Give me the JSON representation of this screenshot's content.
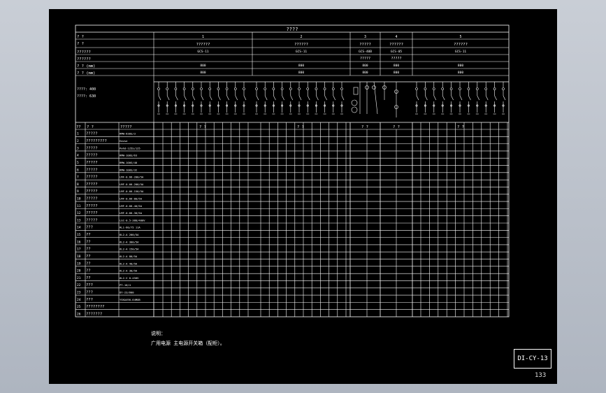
{
  "title": "????",
  "header_rows": {
    "row1_label": "? ?",
    "row2_label": "? ?",
    "row3_label": "??????",
    "row4_label": "??????",
    "row5_label": "? ? (mm)",
    "row6_label": "? ? (mm)"
  },
  "panels": [
    {
      "no": "1",
      "name": "??????",
      "model": "GCS-11",
      "w": "800",
      "d": "800",
      "extra": ""
    },
    {
      "no": "2",
      "name": "??????",
      "model": "GCS-11",
      "w": "800",
      "d": "800",
      "extra": ""
    },
    {
      "no": "3",
      "name": "?????",
      "model": "GCS-40B",
      "w": "800",
      "d": "800",
      "extra": "?????"
    },
    {
      "no": "4",
      "name": "??????",
      "model": "GCS-05",
      "w": "800",
      "d": "800",
      "extra": "?????"
    },
    {
      "no": "5",
      "name": "??????",
      "model": "GCS-11",
      "w": "800",
      "d": "800",
      "extra": ""
    }
  ],
  "scheme_notes": [
    "????: 400",
    "????: 630"
  ],
  "table_header": {
    "col1": "??",
    "col2": "?  ?",
    "col3": "?????",
    "g1": "? ?",
    "g2": "? ?",
    "g3a": "? ?",
    "g3b": "? ?",
    "g5": "? ?"
  },
  "rows": [
    {
      "no": "1",
      "name": "?????",
      "spec": "RMW-630S/3"
    },
    {
      "no": "2",
      "name": "?????????",
      "spec": "Eavse"
    },
    {
      "no": "3",
      "name": "?????",
      "spec": "Pwhd-125S/125"
    },
    {
      "no": "4",
      "name": "?????",
      "spec": "RMW-100S/63"
    },
    {
      "no": "5",
      "name": "?????",
      "spec": "RMW-100S/40"
    },
    {
      "no": "6",
      "name": "?????",
      "spec": "RMW-100S/32"
    },
    {
      "no": "7",
      "name": "?????",
      "spec": "LMF-0.66-200/5A"
    },
    {
      "no": "8",
      "name": "?????",
      "spec": "LMF-0.66-200/5A"
    },
    {
      "no": "9",
      "name": "?????",
      "spec": "LMF-0.66-150/5A"
    },
    {
      "no": "10",
      "name": "?????",
      "spec": "LMF-0.66-80/5A"
    },
    {
      "no": "11",
      "name": "?????",
      "spec": "LMF-0.66-40/5A"
    },
    {
      "no": "12",
      "name": "?????",
      "spec": "LMF-0.66-30/5A"
    },
    {
      "no": "13",
      "name": "?????",
      "spec": "LGC-0.5-380/400V"
    },
    {
      "no": "14",
      "name": "???",
      "spec": "RL1-60/75 11A"
    },
    {
      "no": "15",
      "name": "??",
      "spec": "6L2-A 200/5A"
    },
    {
      "no": "16",
      "name": "??",
      "spec": "6L2-A 300/5A"
    },
    {
      "no": "17",
      "name": "??",
      "spec": "6L2-A 150/5A"
    },
    {
      "no": "18",
      "name": "??",
      "spec": "6L2-A 80/5A"
    },
    {
      "no": "19",
      "name": "??",
      "spec": "6L2-A 40/5A"
    },
    {
      "no": "20",
      "name": "??",
      "spec": "6L2-A 30/5A"
    },
    {
      "no": "21",
      "name": "??",
      "spec": "6L2-V 0-450V"
    },
    {
      "no": "22",
      "name": "???",
      "spec": "PT-10/4"
    },
    {
      "no": "23",
      "name": "???",
      "spec": "DY-23/600"
    },
    {
      "no": "24",
      "name": "???",
      "spec": "YSKA490-64MOB"
    },
    {
      "no": "25",
      "name": "????????",
      "spec": ""
    },
    {
      "no": "26",
      "name": "???????",
      "spec": ""
    }
  ],
  "note": {
    "title": "说明：",
    "line1": "广用电源 主电源开关箱（配柜）。"
  },
  "drawing_no": "DI-CY-13",
  "page_no": "133"
}
